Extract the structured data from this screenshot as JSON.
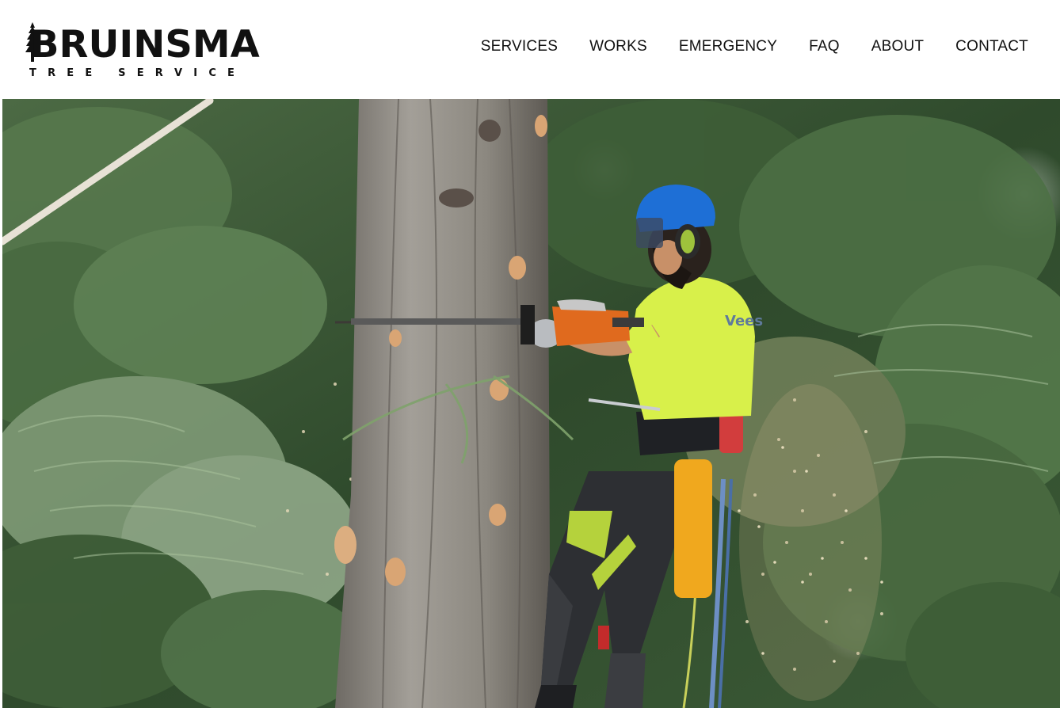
{
  "brand": {
    "name": "BRUINSMA",
    "tagline": "TREE SERVICE"
  },
  "nav": {
    "items": [
      {
        "label": "SERVICES"
      },
      {
        "label": "WORKS"
      },
      {
        "label": "EMERGENCY"
      },
      {
        "label": "FAQ"
      },
      {
        "label": "ABOUT"
      },
      {
        "label": "CONTACT"
      }
    ]
  },
  "hero": {
    "subject": "arborist cutting tree trunk with chainsaw",
    "shirt_text": "Vees"
  },
  "colors": {
    "text": "#111111",
    "background": "#ffffff",
    "foliage": "#3f5e35",
    "trunk": "#8a8680",
    "shirt": "#d8f04a",
    "helmet": "#1e6fd6",
    "chainsaw": "#e06a1e"
  }
}
